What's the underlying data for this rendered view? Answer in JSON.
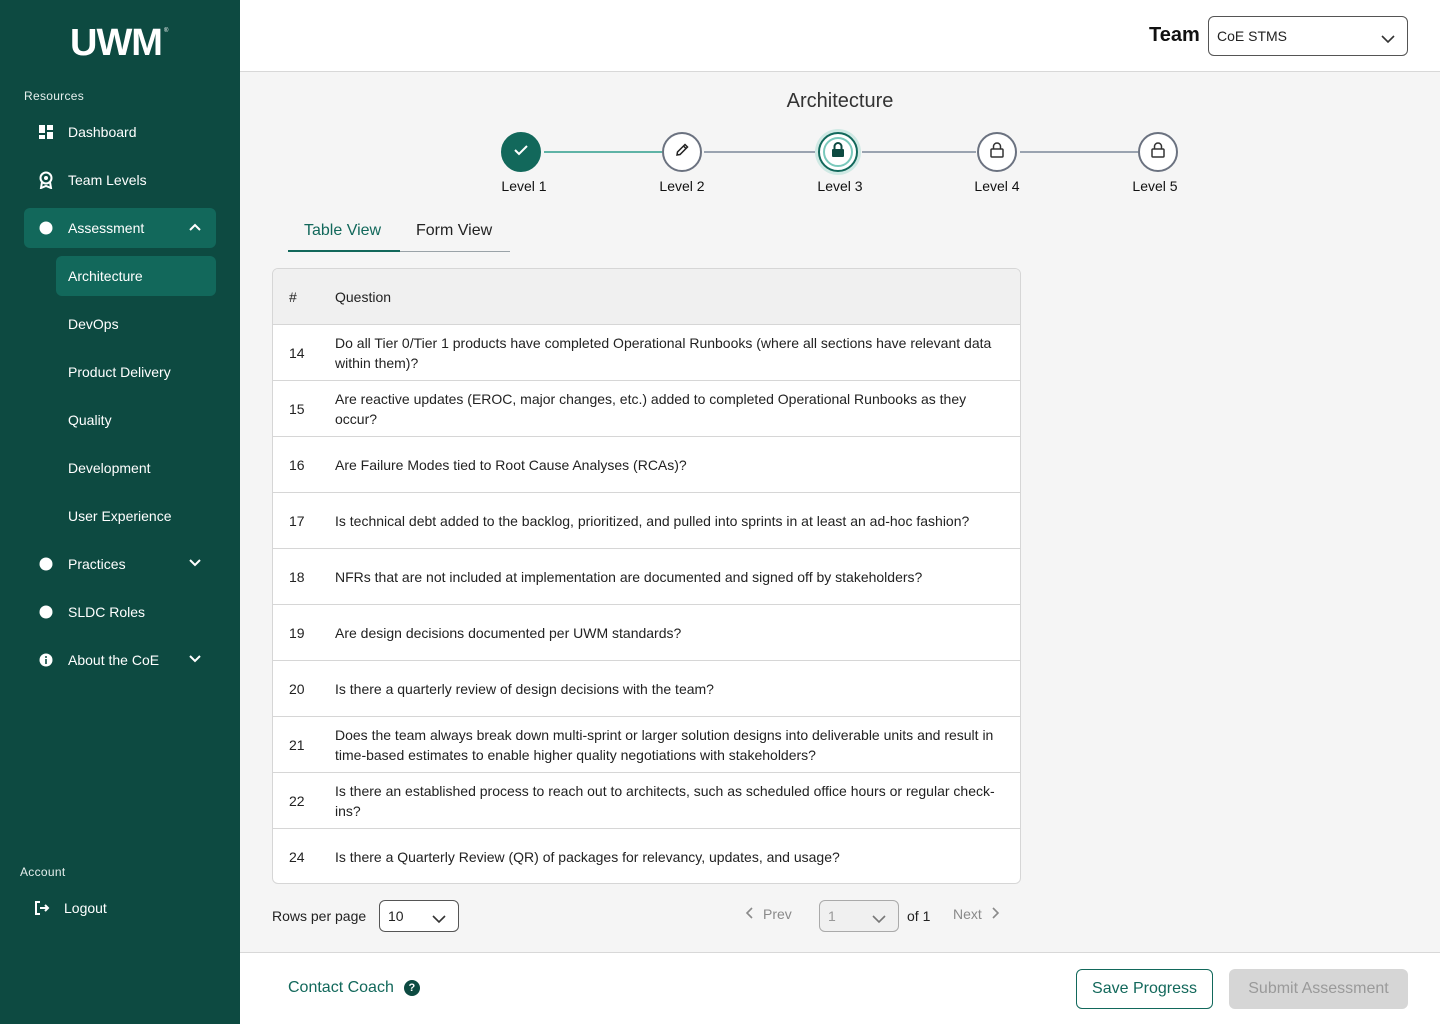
{
  "brand": {
    "logo_text": "UWM",
    "primary_color": "#0d4a41",
    "accent_color": "#12685b"
  },
  "sidebar": {
    "resources_label": "Resources",
    "items": [
      {
        "label": "Dashboard",
        "icon": "dashboard-icon"
      },
      {
        "label": "Team Levels",
        "icon": "award-icon"
      },
      {
        "label": "Assessment",
        "icon": "dot-icon",
        "expanded": true
      },
      {
        "label": "Practices",
        "icon": "dot-icon",
        "expanded": false
      },
      {
        "label": "SLDC Roles",
        "icon": "dot-icon"
      },
      {
        "label": "About the CoE",
        "icon": "info-icon",
        "expanded": false
      }
    ],
    "assessment_subitems": [
      {
        "label": "Architecture",
        "active": true
      },
      {
        "label": "DevOps"
      },
      {
        "label": "Product Delivery"
      },
      {
        "label": "Quality"
      },
      {
        "label": "Development"
      },
      {
        "label": "User Experience"
      }
    ],
    "account_label": "Account",
    "logout_label": "Logout"
  },
  "header": {
    "team_label": "Team",
    "team_value": "CoE STMS"
  },
  "page": {
    "title": "Architecture",
    "levels": [
      {
        "label": "Level 1",
        "state": "completed",
        "icon": "check-icon"
      },
      {
        "label": "Level 2",
        "state": "in-progress",
        "icon": "pencil-icon"
      },
      {
        "label": "Level 3",
        "state": "current-locked",
        "icon": "lock-icon"
      },
      {
        "label": "Level 4",
        "state": "locked",
        "icon": "lock-icon"
      },
      {
        "label": "Level 5",
        "state": "locked",
        "icon": "lock-icon"
      }
    ],
    "tabs": [
      {
        "label": "Table View",
        "active": true
      },
      {
        "label": "Form View",
        "active": false
      }
    ]
  },
  "table": {
    "headers": [
      "#",
      "Question"
    ],
    "rows": [
      {
        "num": "14",
        "question": "Do all Tier 0/Tier 1 products have completed Operational Runbooks (where all sections have relevant data within them)?"
      },
      {
        "num": "15",
        "question": "Are reactive updates (EROC, major changes, etc.) added to completed Operational Runbooks as they occur?"
      },
      {
        "num": "16",
        "question": "Are Failure Modes tied to Root Cause Analyses (RCAs)?"
      },
      {
        "num": "17",
        "question": "Is technical debt added to the backlog, prioritized, and pulled into sprints in at least an ad-hoc fashion?"
      },
      {
        "num": "18",
        "question": "NFRs that are not included at implementation are documented and signed off by stakeholders?"
      },
      {
        "num": "19",
        "question": "Are design decisions documented per UWM standards?"
      },
      {
        "num": "20",
        "question": "Is there a quarterly review of design decisions with the team?"
      },
      {
        "num": "21",
        "question": "Does the team always break down multi-sprint or larger solution designs into deliverable units and result in time-based estimates to enable higher quality negotiations with stakeholders?"
      },
      {
        "num": "22",
        "question": "Is there an established process to reach out to architects, such as scheduled office hours or regular check-ins?"
      },
      {
        "num": "24",
        "question": "Is there a Quarterly Review (QR) of packages for relevancy, updates, and usage?"
      }
    ]
  },
  "pagination": {
    "rows_per_page_label": "Rows per page",
    "rows_per_page": "10",
    "prev_label": "Prev",
    "current_page": "1",
    "of_label": "of 1",
    "next_label": "Next"
  },
  "footer": {
    "contact_label": "Contact Coach",
    "help_glyph": "?",
    "save_label": "Save Progress",
    "submit_label": "Submit Assessment"
  }
}
